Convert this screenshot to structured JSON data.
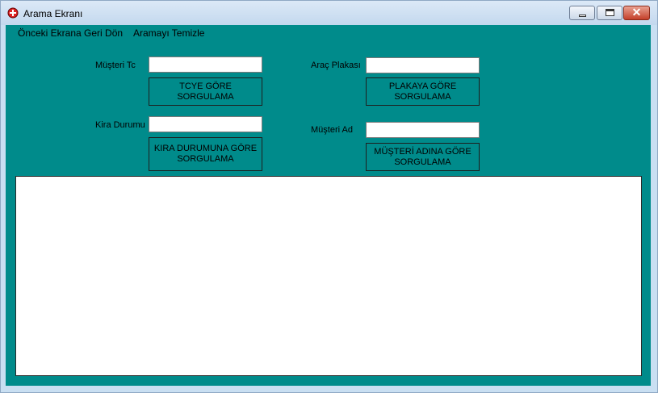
{
  "window": {
    "title": "Arama Ekranı"
  },
  "menu": {
    "back": "Önceki Ekrana Geri Dön",
    "clear": "Aramayı Temizle"
  },
  "form": {
    "tc_label": "Müşteri Tc",
    "tc_value": "",
    "tc_button": "TCYE GÖRE\nSORGULAMA",
    "plate_label": "Araç Plakası",
    "plate_value": "",
    "plate_button": "PLAKAYA GÖRE\nSORGULAMA",
    "rent_label": "Kira Durumu",
    "rent_value": "",
    "rent_button": "KIRA DURUMUNA GÖRE\nSORGULAMA",
    "name_label": "Müşteri Ad",
    "name_value": "",
    "name_button": "MÜŞTERİ ADINA GÖRE\nSORGULAMA"
  },
  "colors": {
    "background": "#008b8b",
    "titlebar": "#c9dff2",
    "close": "#c4402a"
  }
}
